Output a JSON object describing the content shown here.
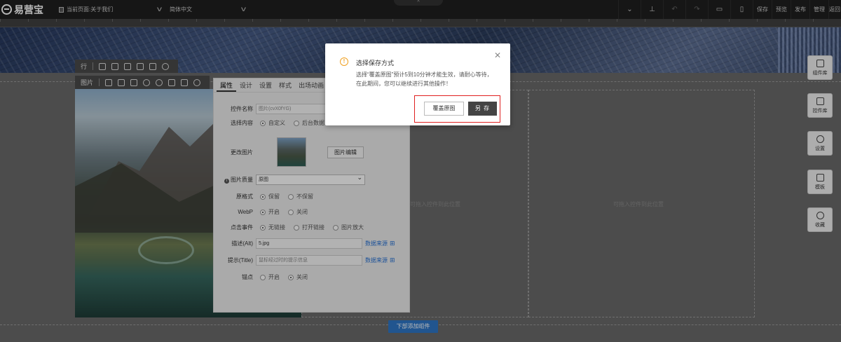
{
  "app": {
    "logo_text": "易营宝"
  },
  "topbar": {
    "current_page": "当前页面:关于我们",
    "language": "简体中文",
    "actions": [
      "保存",
      "预览",
      "发布",
      "管理",
      "返回"
    ]
  },
  "canvas": {
    "image_toolbar_label": "图片",
    "row_toolbar_label": "行",
    "drop_hint": "可拖入控件到此位置",
    "add_bottom": "下部添加组件"
  },
  "props": {
    "tabs": [
      "属性",
      "设计",
      "设置",
      "样式",
      "出场动画"
    ],
    "name_label": "控件名称",
    "name_value": "图片(cvX0fYG)",
    "content_label": "选择内容",
    "content_options": [
      "自定义",
      "后台数据"
    ],
    "change_image_label": "更改图片",
    "edit_image_button": "图片编辑",
    "quality_label": "图片质量",
    "quality_value": "原图",
    "format_label": "原格式",
    "format_options": [
      "保留",
      "不保留"
    ],
    "webp_label": "WebP",
    "webp_options": [
      "开启",
      "关闭"
    ],
    "click_label": "点击事件",
    "click_options": [
      "无链接",
      "打开链接",
      "图片放大"
    ],
    "alt_label": "描述(Alt)",
    "alt_value": "5.jpg",
    "title_label": "提示(Title)",
    "title_placeholder": "鼠标经过时的提示信息",
    "datasource_label": "数据来源",
    "anchor_label": "锚点",
    "anchor_options": [
      "开启",
      "关闭"
    ]
  },
  "sidebar": {
    "items": [
      "组件库",
      "控件库",
      "设置",
      "模板",
      "收藏"
    ]
  },
  "modal": {
    "title": "选择保存方式",
    "body": "选择“覆盖原图”预计5到10分钟才能生效，请耐心等待，在此期间，您可以继续进行其他操作！",
    "overwrite_button": "覆盖原图",
    "save_as_button": "另 存"
  }
}
